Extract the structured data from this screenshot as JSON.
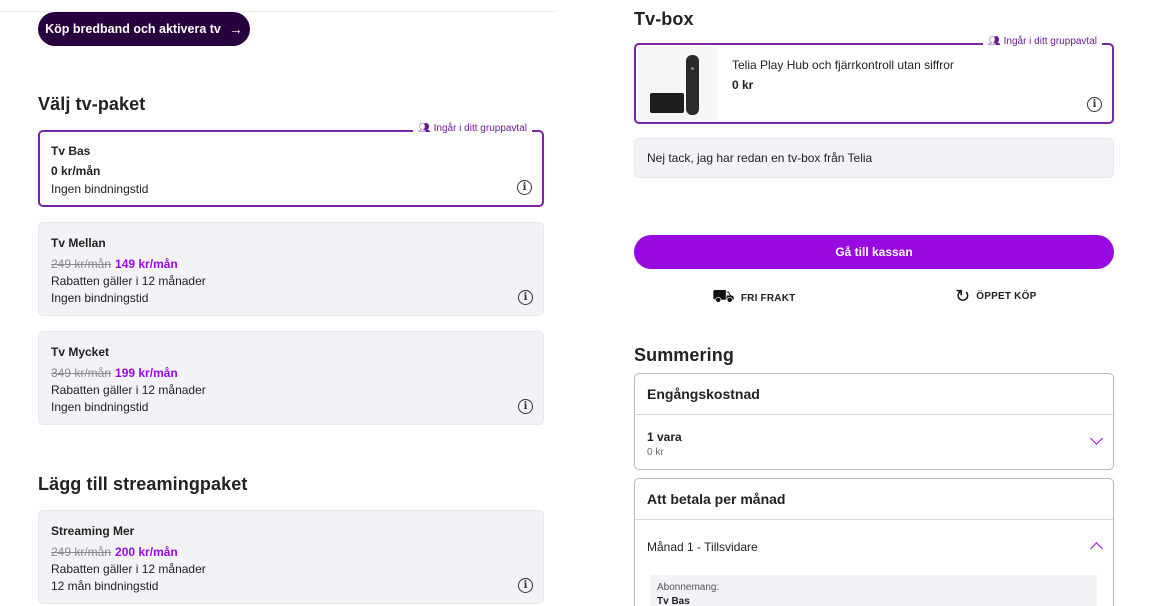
{
  "header": {
    "cta_label": "Köp bredband och aktivera tv",
    "cta_arrow": "→"
  },
  "tv_packages": {
    "title": "Välj tv-paket",
    "badge_text": "Ingår i ditt gruppavtal",
    "items": [
      {
        "name": "Tv Bas",
        "price": "0 kr/mån",
        "lines": [
          "Ingen bindningstid"
        ]
      },
      {
        "name": "Tv Mellan",
        "old_price": "249 kr/mån",
        "new_price": "149 kr/mån",
        "lines": [
          "Rabatten gäller i 12 månader",
          "Ingen bindningstid"
        ]
      },
      {
        "name": "Tv Mycket",
        "old_price": "349 kr/mån",
        "new_price": "199 kr/mån",
        "lines": [
          "Rabatten gäller i 12 månader",
          "Ingen bindningstid"
        ]
      }
    ]
  },
  "streaming": {
    "title": "Lägg till streamingpaket",
    "items": [
      {
        "name": "Streaming Mer",
        "old_price": "249 kr/mån",
        "new_price": "200 kr/mån",
        "lines": [
          "Rabatten gäller i 12 månader",
          "12 mån bindningstid"
        ]
      }
    ]
  },
  "tvbox": {
    "title": "Tv-box",
    "badge_text": "Ingår i ditt gruppavtal",
    "product_name": "Telia Play Hub och fjärrkontroll utan siffror",
    "product_price": "0 kr",
    "no_thanks": "Nej tack, jag har redan en tv-box från Telia"
  },
  "checkout": {
    "button_label": "Gå till kassan",
    "perk_shipping": "FRI FRAKT",
    "perk_return": "ÖPPET KÖP"
  },
  "summary": {
    "title": "Summering",
    "one_time": {
      "heading": "Engångskostnad",
      "items_label": "1 vara",
      "items_sub": "0 kr"
    },
    "monthly": {
      "heading": "Att betala per månad",
      "period_label": "Månad 1 - Tillsvidare",
      "sub_label": "Abonnemang:",
      "sub_value": "Tv Bas"
    }
  },
  "colors": {
    "purple": "#990ae3",
    "dark_purple": "#29003e",
    "selected_border": "#7a24a8"
  }
}
